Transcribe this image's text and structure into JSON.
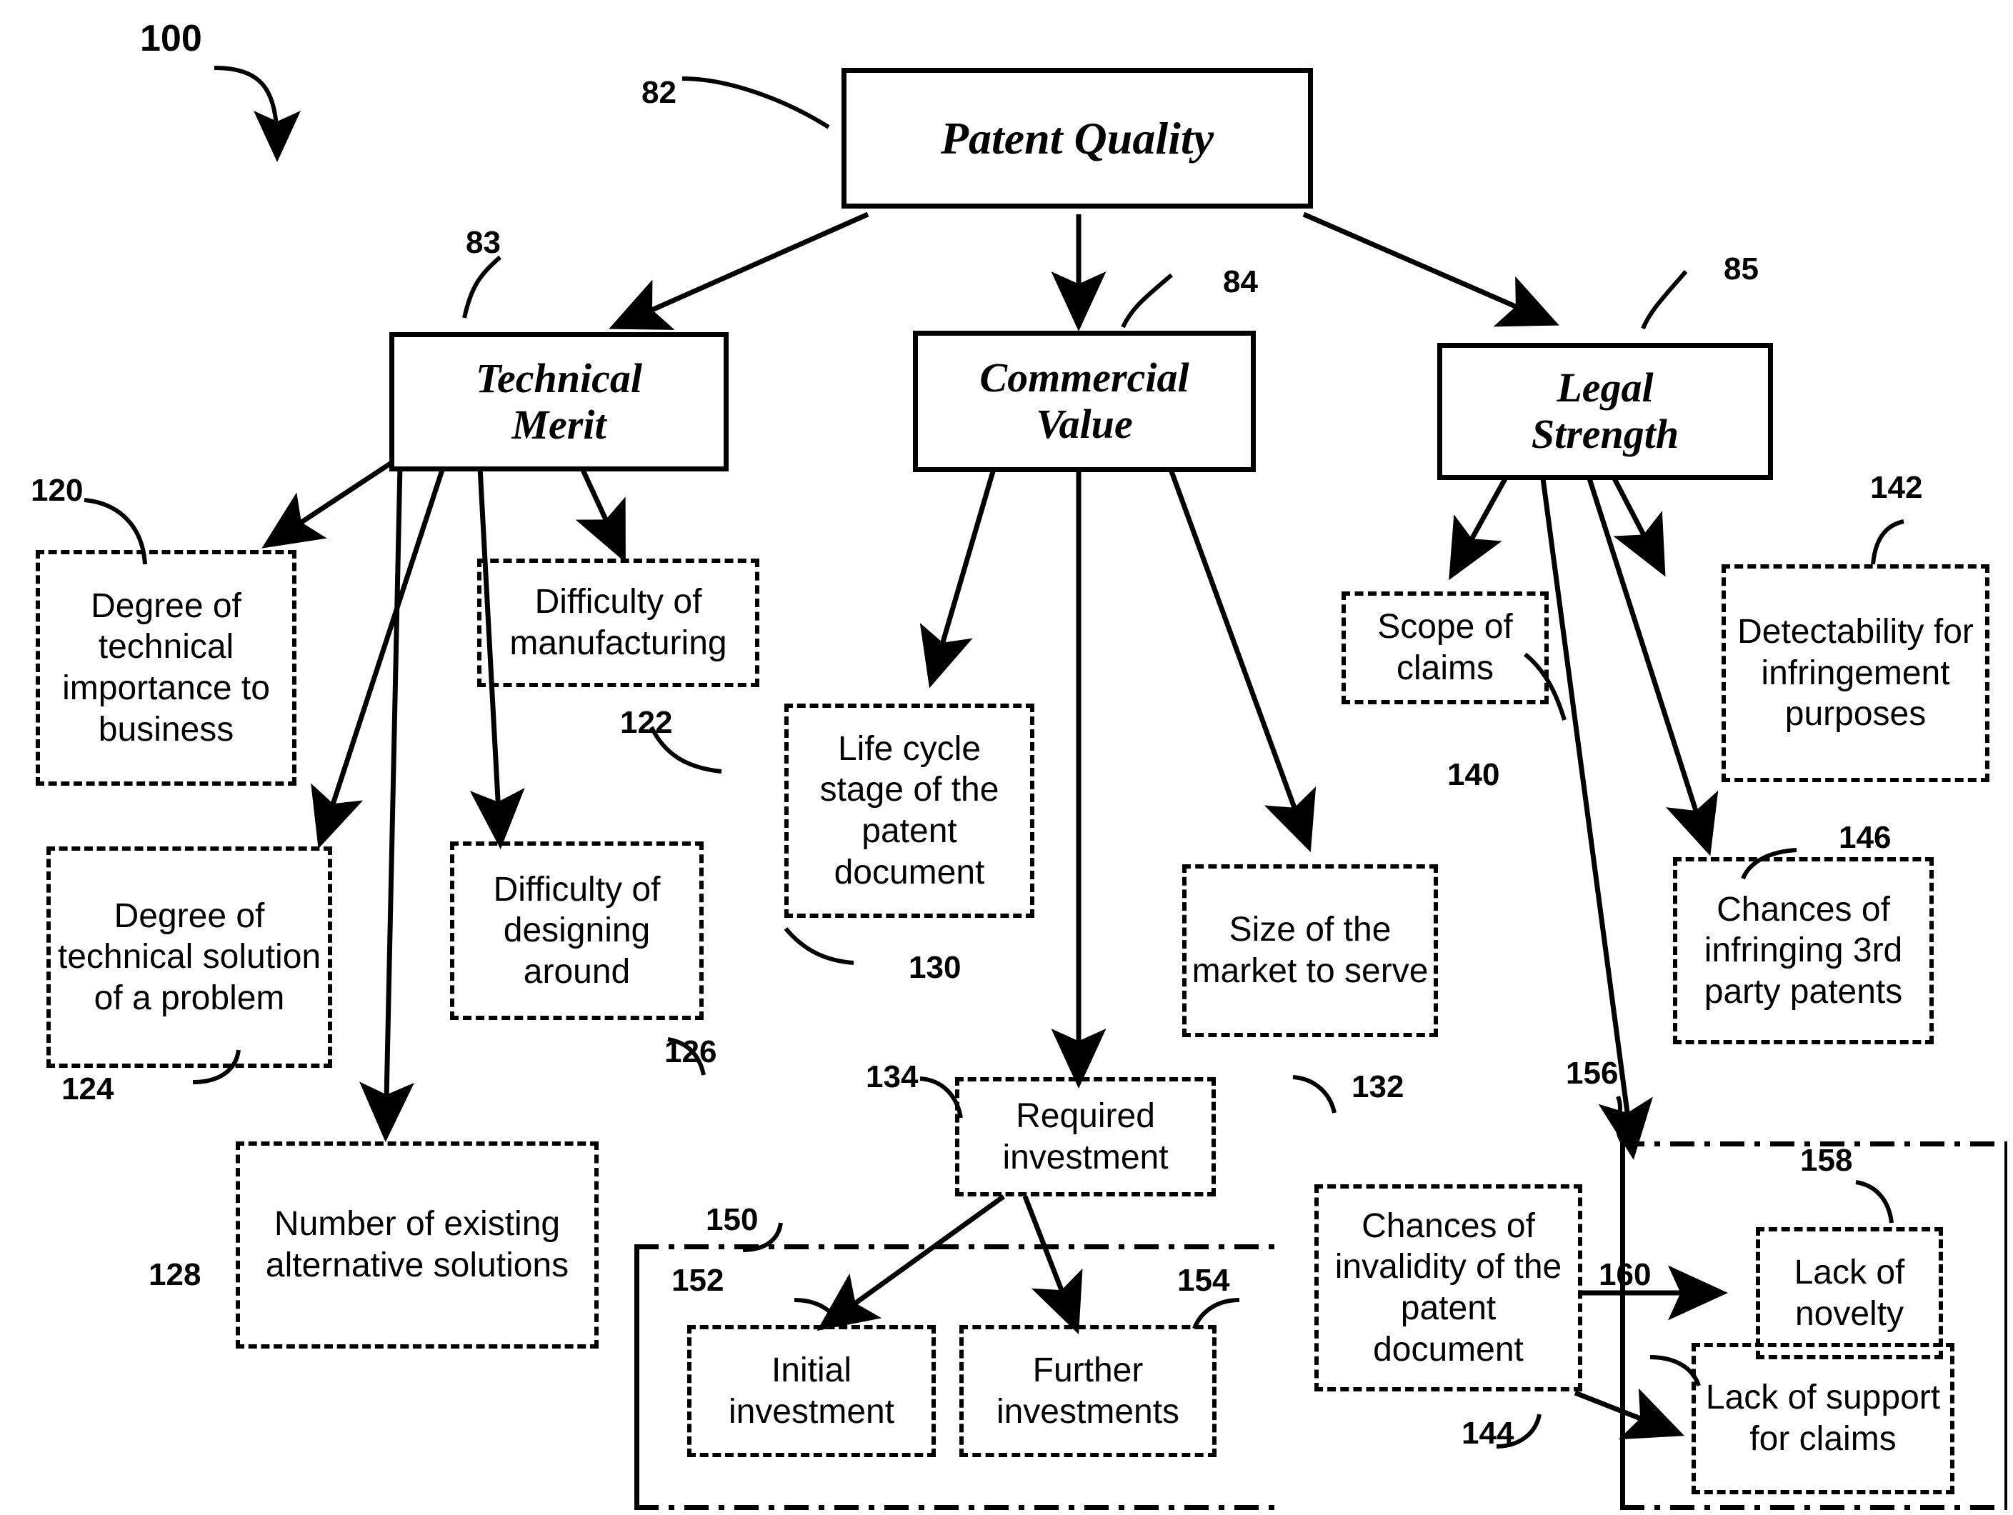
{
  "figure": {
    "figure_ref": "100",
    "root": {
      "ref": "82",
      "label": "Patent Quality"
    },
    "categories": [
      {
        "ref": "83",
        "label": "Technical\nMerit"
      },
      {
        "ref": "84",
        "label": "Commercial\nValue"
      },
      {
        "ref": "85",
        "label": "Legal\nStrength"
      }
    ],
    "nodes": {
      "n120": {
        "ref": "120",
        "label": "Degree of technical importance to business"
      },
      "n122": {
        "ref": "122",
        "label": "Difficulty of manufacturing"
      },
      "n124": {
        "ref": "124",
        "label": "Degree of technical solution of a problem"
      },
      "n126": {
        "ref": "126",
        "label": "Difficulty of designing around"
      },
      "n128": {
        "ref": "128",
        "label": "Number of existing alternative solutions"
      },
      "n130": {
        "ref": "130",
        "label": "Life cycle stage of the patent document"
      },
      "n132": {
        "ref": "132",
        "label": "Size of the market to serve"
      },
      "n134": {
        "ref": "134",
        "label": "Required investment"
      },
      "n140": {
        "ref": "140",
        "label": "Scope of claims"
      },
      "n142": {
        "ref": "142",
        "label": "Detectability for infringement purposes"
      },
      "n144": {
        "ref": "144",
        "label": "Chances of invalidity of the patent document"
      },
      "n146": {
        "ref": "146",
        "label": "Chances of infringing 3rd party patents"
      },
      "n150": {
        "ref": "150",
        "label": ""
      },
      "n152": {
        "ref": "152",
        "label": "Initial investment"
      },
      "n154": {
        "ref": "154",
        "label": "Further investments"
      },
      "n156": {
        "ref": "156",
        "label": ""
      },
      "n158": {
        "ref": "158",
        "label": "Lack of novelty"
      },
      "n160": {
        "ref": "160",
        "label": "Lack of support for claims"
      }
    },
    "colors": {
      "ink": "#000000",
      "paper": "#ffffff"
    }
  }
}
